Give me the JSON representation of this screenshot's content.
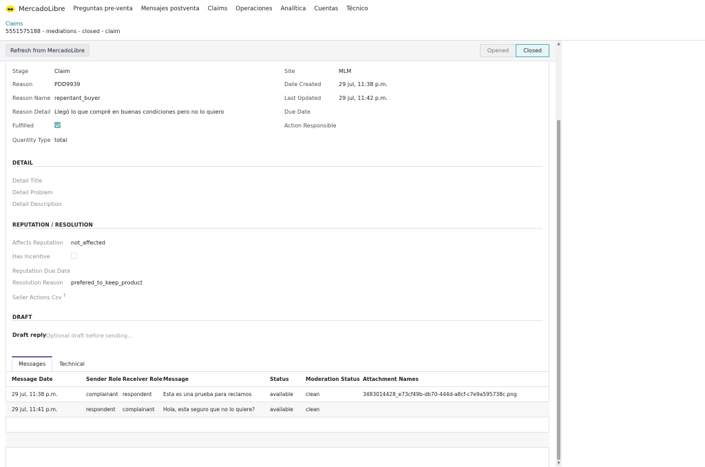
{
  "nav": {
    "brand": "MercadoLibre",
    "brand_icon": "handshake-logo-icon",
    "items": [
      "Preguntas pre-venta",
      "Mensajes postventa",
      "Claims",
      "Operaciones",
      "Analítica",
      "Cuentas",
      "Técnico"
    ]
  },
  "breadcrumb": {
    "parent": "Claims",
    "current": "5551575188 - mediations - closed - claim"
  },
  "toolbar": {
    "refresh_label": "Refresh from MercadoLibre",
    "stages": [
      "Opened",
      "Closed"
    ],
    "active_stage": "Closed"
  },
  "fields": {
    "stage": {
      "label": "Stage",
      "value": "Claim"
    },
    "reason": {
      "label": "Reason",
      "value": "PDD9939"
    },
    "reason_name": {
      "label": "Reason Name",
      "value": "repentant_buyer"
    },
    "reason_detail": {
      "label": "Reason Detail",
      "value": "Llegó lo que compré en buenas condiciones pero no lo quiero"
    },
    "fulfilled": {
      "label": "Fulfilled",
      "checked": true
    },
    "quantity_type": {
      "label": "Quantity Type",
      "value": "total"
    },
    "site": {
      "label": "Site",
      "value": "MLM"
    },
    "date_created": {
      "label": "Date Created",
      "value": "29 jul, 11:38 p.m."
    },
    "last_updated": {
      "label": "Last Updated",
      "value": "29 jul, 11:42 p.m."
    },
    "due_date": {
      "label": "Due Date",
      "value": ""
    },
    "action_responsible": {
      "label": "Action Responsible",
      "value": ""
    }
  },
  "detail": {
    "title": "DETAIL",
    "detail_title": "Detail Title",
    "detail_problem": "Detail Problem",
    "detail_description": "Detail Description"
  },
  "reputation": {
    "title": "REPUTATION / RESOLUTION",
    "affects_reputation": {
      "label": "Affects Reputation",
      "value": "not_affected"
    },
    "has_incentive": {
      "label": "Has Incentive",
      "checked": false
    },
    "reputation_due_date": {
      "label": "Reputation Due Date",
      "value": ""
    },
    "resolution_reason": {
      "label": "Resolution Reason",
      "value": "prefered_to_keep_product"
    },
    "seller_actions_csv": {
      "label": "Seller Actions Csv",
      "help": "?"
    }
  },
  "draft": {
    "title": "DRAFT",
    "label": "Draft reply",
    "placeholder": "Optional draft before sending..."
  },
  "tabs": [
    "Messages",
    "Technical"
  ],
  "messages_table": {
    "columns": [
      "Message Date",
      "Sender Role",
      "Receiver Role",
      "Message",
      "Status",
      "Moderation Status",
      "Attachment Names"
    ],
    "rows": [
      [
        "29 jul, 11:38 p.m.",
        "complainant",
        "respondent",
        "Esta es una prueba para reclamos",
        "available",
        "clean",
        "3483014428_e73cf49b-db70-444d-a8cf-c7e9a595738c.png"
      ],
      [
        "29 jul, 11:41 p.m.",
        "respondent",
        "complainant",
        "Hola, esta seguro que no lo quiere?",
        "available",
        "clean",
        ""
      ]
    ]
  },
  "colors": {
    "accent": "#017e84",
    "tab_accent": "#71639e",
    "checkbox": "#6fb7ba"
  }
}
